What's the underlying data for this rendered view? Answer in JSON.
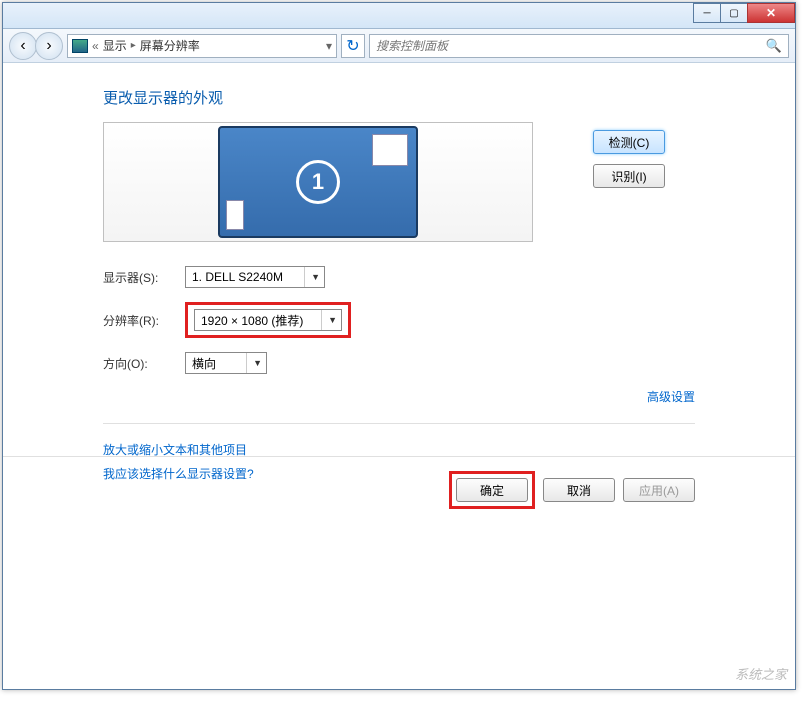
{
  "titlebar": {
    "min": "─",
    "max": "▢",
    "close": "✕"
  },
  "nav": {
    "back": "‹",
    "fwd": "›",
    "crumb_prefix": "«",
    "crumb1": "显示",
    "crumb_sep": "▸",
    "crumb2": "屏幕分辨率",
    "dd": "▾",
    "refresh": "↻"
  },
  "search": {
    "placeholder": "搜索控制面板",
    "icon": "🔍"
  },
  "heading": "更改显示器的外观",
  "monitor_number": "1",
  "buttons": {
    "detect": "检测(C)",
    "identify": "识别(I)"
  },
  "form": {
    "display_label": "显示器(S):",
    "display_value": "1. DELL S2240M",
    "resolution_label": "分辨率(R):",
    "resolution_value": "1920 × 1080 (推荐)",
    "orientation_label": "方向(O):",
    "orientation_value": "横向",
    "arrow": "▼"
  },
  "links": {
    "advanced": "高级设置",
    "scale_text": "放大或缩小文本和其他项目",
    "which_display": "我应该选择什么显示器设置?"
  },
  "footer": {
    "ok": "确定",
    "cancel": "取消",
    "apply": "应用(A)"
  },
  "watermark": "系统之家"
}
